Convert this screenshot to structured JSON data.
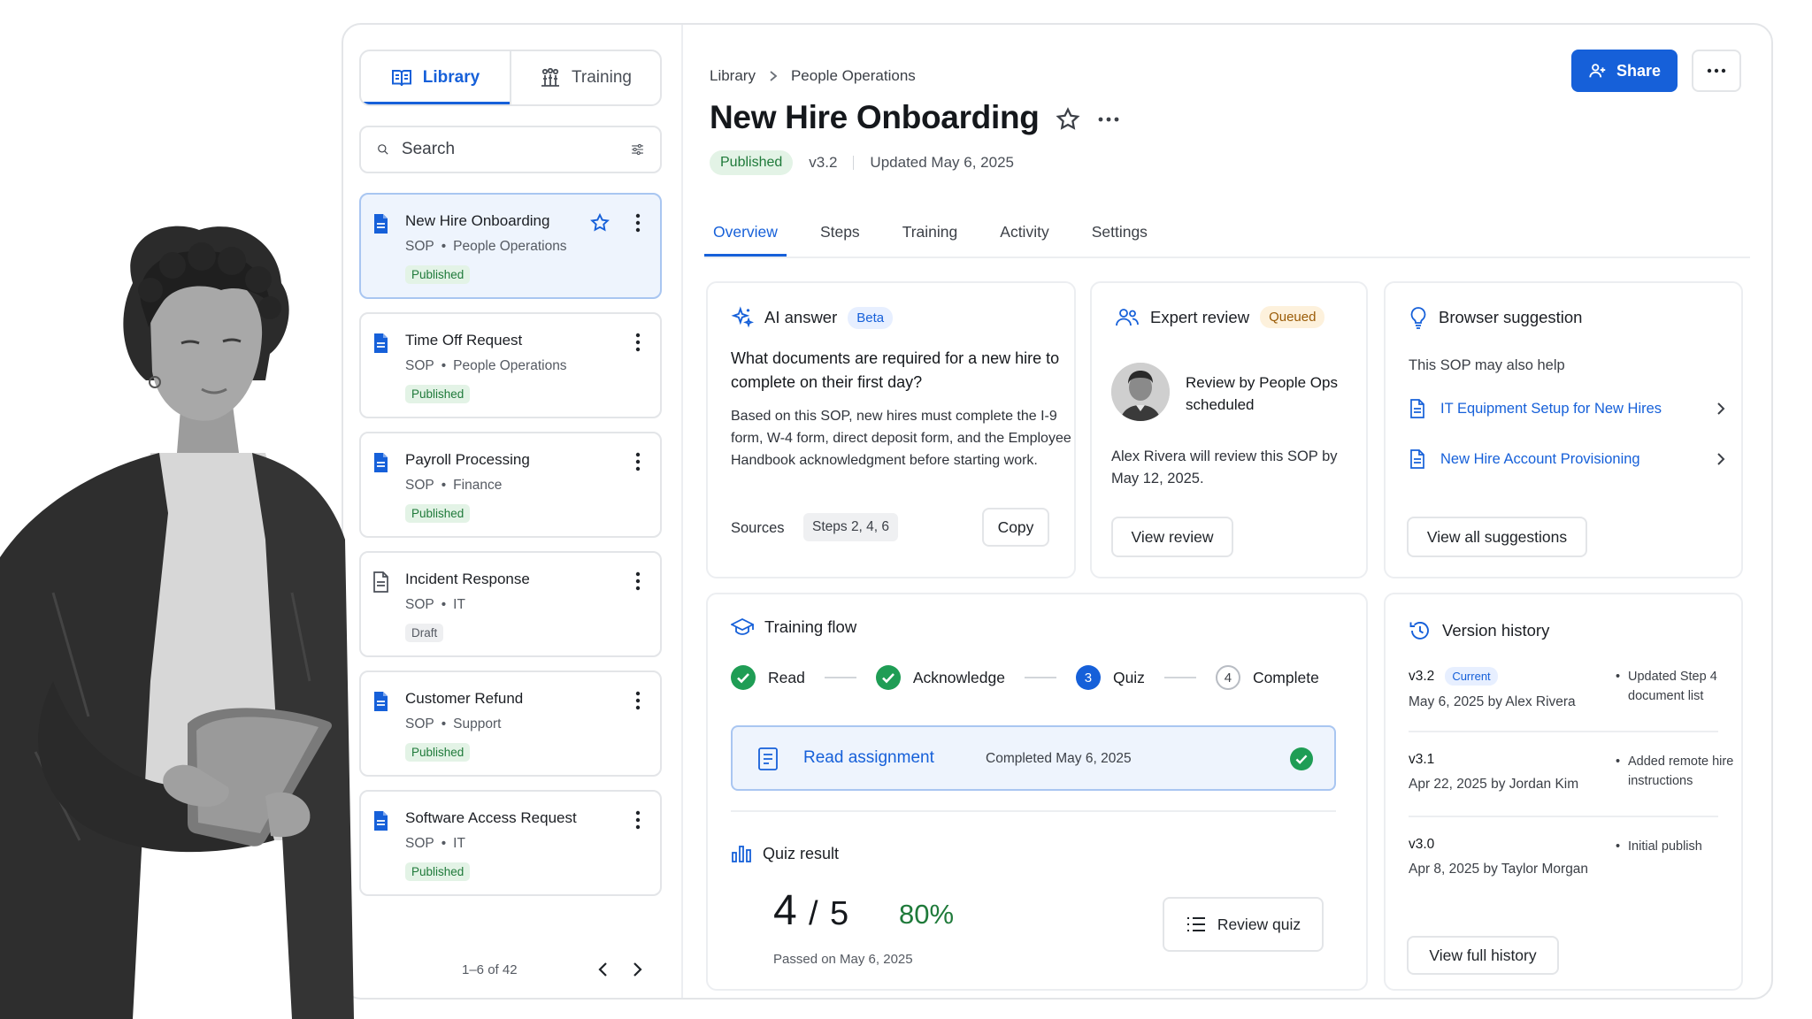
{
  "sidebar": {
    "tabs": [
      {
        "label": "Library",
        "icon": "book-open-icon",
        "active": true
      },
      {
        "label": "Training",
        "icon": "training-icon",
        "active": false
      }
    ],
    "search": {
      "placeholder": "Search"
    },
    "documents": [
      {
        "title": "New Hire Onboarding",
        "type": "SOP",
        "department": "People Operations",
        "status": "Published",
        "starred": true,
        "active": true
      },
      {
        "title": "Time Off Request",
        "type": "SOP",
        "department": "People Operations",
        "status": "Published"
      },
      {
        "title": "Payroll Processing",
        "type": "SOP",
        "department": "Finance",
        "status": "Published"
      },
      {
        "title": "Incident Response",
        "type": "SOP",
        "department": "IT",
        "status": "Draft"
      },
      {
        "title": "Customer Refund",
        "type": "SOP",
        "department": "Support",
        "status": "Published"
      },
      {
        "title": "Software Access Request",
        "type": "SOP",
        "department": "IT",
        "status": "Published"
      }
    ],
    "meta_separator": "•",
    "pagination": {
      "text": "1–6 of 42"
    }
  },
  "header": {
    "breadcrumb": [
      "Library",
      "People Operations"
    ],
    "title": "New Hire Onboarding",
    "status": "Published",
    "version": "v3.2",
    "updated": "Updated May 6, 2025",
    "share_label": "Share"
  },
  "tabs": [
    {
      "label": "Overview",
      "active": true
    },
    {
      "label": "Steps"
    },
    {
      "label": "Training"
    },
    {
      "label": "Activity"
    },
    {
      "label": "Settings"
    }
  ],
  "ai_answer": {
    "title": "AI answer",
    "badge": "Beta",
    "question": "What documents are required for a new hire to complete on their first day?",
    "answer": "Based on this SOP, new hires must complete the I-9 form, W-4 form, direct deposit form, and the Employee Handbook acknowledgment before starting work.",
    "sources_label": "Sources",
    "sources_value": "Steps 2, 4, 6",
    "copy_label": "Copy"
  },
  "expert_review": {
    "title": "Expert review",
    "badge": "Queued",
    "review_title": "Review by People Ops scheduled",
    "text": "Alex Rivera will review this SOP by May 12, 2025.",
    "button": "View review"
  },
  "browser_suggestion": {
    "title": "Browser suggestion",
    "subtitle": "This SOP may also help",
    "links": [
      "IT Equipment Setup for New Hires",
      "New Hire Account Provisioning"
    ],
    "button": "View all suggestions"
  },
  "training_flow": {
    "title": "Training flow",
    "steps": [
      {
        "label": "Read",
        "state": "done"
      },
      {
        "label": "Acknowledge",
        "state": "done"
      },
      {
        "label": "Quiz",
        "state": "current",
        "number": "3"
      },
      {
        "label": "Complete",
        "state": "todo",
        "number": "4"
      }
    ],
    "assignment": {
      "title": "Read assignment",
      "completed": "Completed May 6, 2025"
    }
  },
  "quiz_result": {
    "title": "Quiz result",
    "score": "4",
    "separator": "/",
    "total": "5",
    "percent": "80%",
    "passed": "Passed on May 6, 2025",
    "button": "Review quiz"
  },
  "version_history": {
    "title": "Version history",
    "versions": [
      {
        "version": "v3.2",
        "badge": "Current",
        "by": "May 6, 2025 by Alex Rivera",
        "note": "Updated Step 4 document list"
      },
      {
        "version": "v3.1",
        "by": "Apr 22, 2025 by Jordan Kim",
        "note": "Added remote hire instructions"
      },
      {
        "version": "v3.0",
        "by": "Apr 8, 2025 by Taylor Morgan",
        "note": "Initial publish"
      }
    ],
    "button": "View full history"
  },
  "colors": {
    "primary": "#1660d9",
    "success": "#1f9d55",
    "published_bg": "#e3f3e6",
    "border": "#e3e5e8"
  }
}
